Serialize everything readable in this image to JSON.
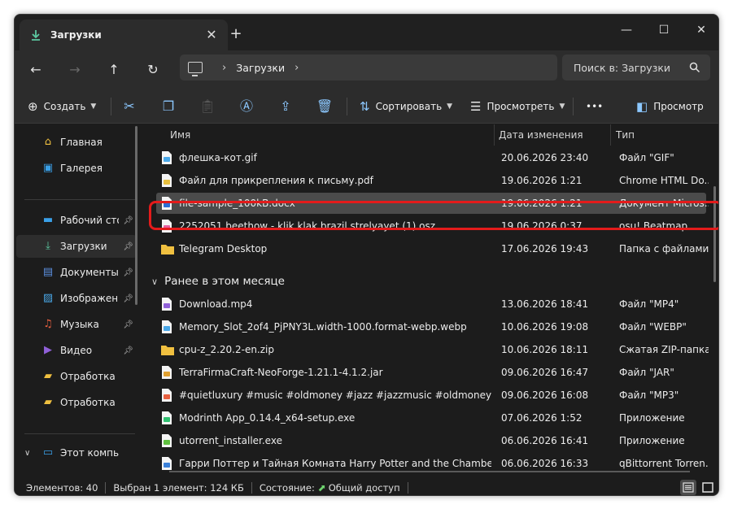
{
  "tab": {
    "title": "Загрузки",
    "icon": "download-icon"
  },
  "address": {
    "crumb": "Загрузки",
    "icon": "this-pc-icon"
  },
  "search": {
    "placeholder": "Поиск в: Загрузки"
  },
  "toolbar": {
    "create_label": "Создать",
    "sort_label": "Сортировать",
    "view_label": "Просмотреть",
    "more_label": "•••",
    "preview_label": "Просмотр"
  },
  "sidebar": {
    "items": [
      {
        "label": "Главная",
        "icon": "home-icon",
        "color": "#f0c040"
      },
      {
        "label": "Галерея",
        "icon": "gallery-icon",
        "color": "#3aa0e8"
      },
      {
        "label": "Рабочий сто",
        "icon": "desktop-icon",
        "color": "#3aa0e8",
        "pinned": true
      },
      {
        "label": "Загрузки",
        "icon": "download-icon",
        "color": "#5cc8a0",
        "pinned": true,
        "active": true
      },
      {
        "label": "Документы",
        "icon": "documents-icon",
        "color": "#5c8fe0",
        "pinned": true
      },
      {
        "label": "Изображени",
        "icon": "pictures-icon",
        "color": "#4aa8e8",
        "pinned": true
      },
      {
        "label": "Музыка",
        "icon": "music-icon",
        "color": "#e86040",
        "pinned": true
      },
      {
        "label": "Видео",
        "icon": "video-icon",
        "color": "#9060d8",
        "pinned": true
      },
      {
        "label": "Отработка",
        "icon": "folder-icon",
        "color": "#f0c040"
      },
      {
        "label": "Отработка",
        "icon": "folder-icon",
        "color": "#f0c040"
      },
      {
        "label": "Этот компьютер",
        "icon": "this-pc-icon",
        "color": "#3aa0e8"
      }
    ]
  },
  "columns": {
    "name": "Имя",
    "date": "Дата изменения",
    "type": "Тип"
  },
  "files_today": [
    {
      "name": "флешка-кот.gif",
      "date": "20.06.2026 23:40",
      "type": "Файл \"GIF\"",
      "icon": "image-file-icon",
      "color": "#4aa8e8"
    },
    {
      "name": "Файл для прикрепления к письму.pdf",
      "date": "19.06.2026 1:21",
      "type": "Chrome HTML Do...",
      "icon": "chrome-pdf-icon",
      "color": "#e8c040"
    },
    {
      "name": "file-sample_100kB.docx",
      "date": "19.06.2026 1:21",
      "type": "Документ Micros...",
      "icon": "word-file-icon",
      "color": "#2b6fd6",
      "selected": true
    },
    {
      "name": "2252051 beethow - klik klak brazil strelyayet (1).osz",
      "date": "19.06.2026 0:37",
      "type": "osu! Beatmap",
      "icon": "osu-file-icon",
      "color": "#e860a0"
    },
    {
      "name": "Telegram Desktop",
      "date": "17.06.2026 19:43",
      "type": "Папка с файлами",
      "icon": "folder-icon",
      "color": "#f0c040"
    }
  ],
  "group_month": {
    "label": "Ранее в этом месяце"
  },
  "files_month": [
    {
      "name": "Download.mp4",
      "date": "13.06.2026 18:41",
      "type": "Файл \"MP4\"",
      "icon": "video-file-icon",
      "color": "#9060d8"
    },
    {
      "name": "Memory_Slot_2of4_PjPNY3L.width-1000.format-webp.webp",
      "date": "10.06.2026 19:08",
      "type": "Файл \"WEBP\"",
      "icon": "image-file-icon",
      "color": "#4aa8e8"
    },
    {
      "name": "cpu-z_2.20.2-en.zip",
      "date": "10.06.2026 18:11",
      "type": "Сжатая ZIP-папка",
      "icon": "zip-folder-icon",
      "color": "#f0c040"
    },
    {
      "name": "TerraFirmaCraft-NeoForge-1.21.1-4.1.2.jar",
      "date": "09.06.2026 16:47",
      "type": "Файл \"JAR\"",
      "icon": "jar-file-icon",
      "color": "#e0a030"
    },
    {
      "name": "#quietluxury #music #oldmoney #jazz #jazzmusic #oldmoneyaesthetic...",
      "date": "09.06.2026 16:08",
      "type": "Файл \"MP3\"",
      "icon": "audio-file-icon",
      "color": "#e86040"
    },
    {
      "name": "Modrinth App_0.14.4_x64-setup.exe",
      "date": "07.06.2026 1:52",
      "type": "Приложение",
      "icon": "modrinth-app-icon",
      "color": "#30c070"
    },
    {
      "name": "utorrent_installer.exe",
      "date": "06.06.2026 16:41",
      "type": "Приложение",
      "icon": "utorrent-app-icon",
      "color": "#60c040"
    },
    {
      "name": "Гарри Поттер и Тайная Комната Harry Potter and the Chamber of Se...",
      "date": "06.06.2026 16:33",
      "type": "qBittorrent Torren...",
      "icon": "qbittorrent-file-icon",
      "color": "#3a80d8"
    }
  ],
  "status": {
    "items_count": "Элементов: 40",
    "selected": "Выбран 1 элемент: 124 КБ",
    "state": "Состояние:",
    "share": "Общий доступ"
  }
}
